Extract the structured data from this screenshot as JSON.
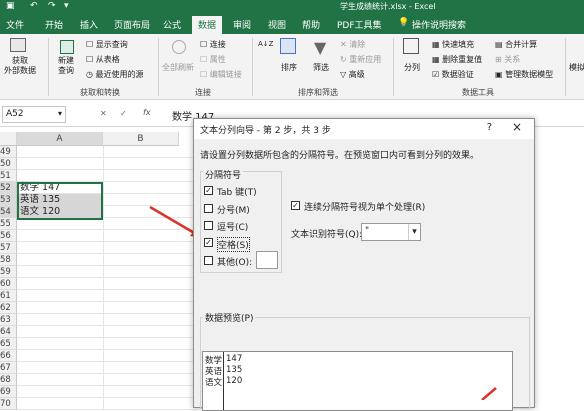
{
  "window": {
    "title": "学生成绩统计.xlsx  -  Excel"
  },
  "menu": {
    "tabs": [
      "文件",
      "开始",
      "插入",
      "页面布局",
      "公式",
      "数据",
      "审阅",
      "视图",
      "帮助",
      "PDF工具集"
    ],
    "active_tab": "数据",
    "tell_me": "操作说明搜索"
  },
  "ribbon": {
    "get_data": "获取\n外部数据",
    "new_query": "新建\n查询",
    "show_query": "显示查询",
    "from_table": "从表格",
    "recent_sources": "最近使用的源",
    "group_get_transform": "获取和转换",
    "refresh_all": "全部刷新",
    "connections": "连接",
    "properties": "属性",
    "edit_links": "编辑链接",
    "group_connections": "连接",
    "sort_az": "A↓Z",
    "sort": "排序",
    "filter": "筛选",
    "clear": "清除",
    "reapply": "重新应用",
    "advanced": "高级",
    "group_sort_filter": "排序和筛选",
    "text_to_columns": "分列",
    "flash_fill": "快速填充",
    "remove_duplicates": "删除重复值",
    "data_validation": "数据验证",
    "consolidate": "合并计算",
    "relationships": "关系",
    "manage_data_model": "管理数据模型",
    "group_data_tools": "数据工具",
    "what_if": "模拟"
  },
  "formula_bar": {
    "name_box": "A52",
    "fx": "fx",
    "content": "数学 147"
  },
  "grid": {
    "columns": [
      "A",
      "B"
    ],
    "rows": [
      {
        "n": "49",
        "a": ""
      },
      {
        "n": "50",
        "a": ""
      },
      {
        "n": "51",
        "a": ""
      },
      {
        "n": "52",
        "a": "数学 147"
      },
      {
        "n": "53",
        "a": "英语 135"
      },
      {
        "n": "54",
        "a": "语文 120"
      },
      {
        "n": "55",
        "a": ""
      },
      {
        "n": "56",
        "a": ""
      },
      {
        "n": "57",
        "a": ""
      },
      {
        "n": "58",
        "a": ""
      },
      {
        "n": "59",
        "a": ""
      },
      {
        "n": "60",
        "a": ""
      },
      {
        "n": "61",
        "a": ""
      },
      {
        "n": "62",
        "a": ""
      },
      {
        "n": "63",
        "a": ""
      },
      {
        "n": "64",
        "a": ""
      },
      {
        "n": "65",
        "a": ""
      },
      {
        "n": "66",
        "a": ""
      },
      {
        "n": "67",
        "a": ""
      },
      {
        "n": "68",
        "a": ""
      },
      {
        "n": "69",
        "a": ""
      },
      {
        "n": "70",
        "a": ""
      }
    ]
  },
  "dialog": {
    "title": "文本分列向导 - 第 2 步，共 3 步",
    "help": "?",
    "close": "×",
    "instruction": "请设置分列数据所包含的分隔符号。在预览窗口内可看到分列的效果。",
    "delimiters_label": "分隔符号",
    "tab": "Tab 键(T)",
    "semicolon": "分号(M)",
    "comma": "逗号(C)",
    "space": "空格(S)",
    "other": "其他(O):",
    "consecutive": "连续分隔符号视为单个处理(R)",
    "qualifier_label": "文本识别符号(Q):",
    "qualifier_value": "\"",
    "preview_label": "数据预览(P)",
    "preview_rows": [
      [
        "数学",
        "147"
      ],
      [
        "英语",
        "135"
      ],
      [
        "语文",
        "120"
      ]
    ]
  }
}
